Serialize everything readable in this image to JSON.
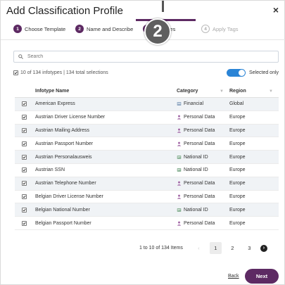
{
  "dialog": {
    "title": "Add Classification Profile",
    "close_label": "×",
    "callout_number": "2"
  },
  "steps": [
    {
      "num": "1",
      "label": "Choose Template",
      "state": "done"
    },
    {
      "num": "2",
      "label": "Name and Describe",
      "state": "done"
    },
    {
      "num": "3",
      "label": "Infotypes",
      "state": "active"
    },
    {
      "num": "4",
      "label": "Apply Tags",
      "state": "inactive"
    }
  ],
  "search": {
    "placeholder": "Search"
  },
  "summary": {
    "text": "10 of 134 infotypes | 134 total selections"
  },
  "toggle": {
    "label": "Selected only",
    "on": true,
    "color": "#2a84d6"
  },
  "table": {
    "headers": {
      "name": "Infotype Name",
      "category": "Category",
      "region": "Region"
    },
    "rows": [
      {
        "name": "American Express",
        "category": "Financial",
        "cat_icon": "bank-icon",
        "region": "Global"
      },
      {
        "name": "Austrian Driver License Number",
        "category": "Personal Data",
        "cat_icon": "person-icon",
        "region": "Europe"
      },
      {
        "name": "Austrian Mailing Address",
        "category": "Personal Data",
        "cat_icon": "person-icon",
        "region": "Europe"
      },
      {
        "name": "Austrian Passport Number",
        "category": "Personal Data",
        "cat_icon": "person-icon",
        "region": "Europe"
      },
      {
        "name": "Austrian Personalausweis",
        "category": "National ID",
        "cat_icon": "id-card-icon",
        "region": "Europe"
      },
      {
        "name": "Austrian SSN",
        "category": "National ID",
        "cat_icon": "id-card-icon",
        "region": "Europe"
      },
      {
        "name": "Austrian Telephone Number",
        "category": "Personal Data",
        "cat_icon": "person-icon",
        "region": "Europe"
      },
      {
        "name": "Belgian Driver License Number",
        "category": "Personal Data",
        "cat_icon": "person-icon",
        "region": "Europe"
      },
      {
        "name": "Belgian National Number",
        "category": "National ID",
        "cat_icon": "id-card-icon",
        "region": "Europe"
      },
      {
        "name": "Belgian Passport Number",
        "category": "Personal Data",
        "cat_icon": "person-icon",
        "region": "Europe"
      }
    ]
  },
  "pagination": {
    "info": "1 to 10 of 134 Items",
    "prev": "‹",
    "pages": [
      "1",
      "2",
      "3"
    ],
    "current": "1",
    "next": "›"
  },
  "footer": {
    "back_label": "Back",
    "next_label": "Next"
  },
  "colors": {
    "accent": "#5d2a63",
    "toggle": "#2a84d6"
  }
}
